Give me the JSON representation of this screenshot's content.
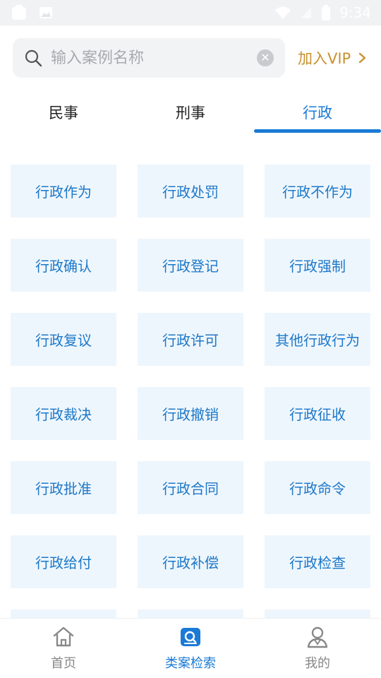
{
  "status_bar": {
    "time": "9:34",
    "left_icons": [
      "notification-icon",
      "image-icon"
    ],
    "right_icons": [
      "wifi-icon",
      "signal-icon",
      "battery-icon"
    ]
  },
  "search": {
    "placeholder": "输入案例名称",
    "value": ""
  },
  "vip": {
    "label": "加入VIP"
  },
  "tabs": [
    {
      "label": "民事",
      "active": false
    },
    {
      "label": "刑事",
      "active": false
    },
    {
      "label": "行政",
      "active": true
    }
  ],
  "categories": [
    "行政作为",
    "行政处罚",
    "行政不作为",
    "行政确认",
    "行政登记",
    "行政强制",
    "行政复议",
    "行政许可",
    "其他行政行为",
    "行政裁决",
    "行政撤销",
    "行政征收",
    "行政批准",
    "行政合同",
    "行政命令",
    "行政给付",
    "行政补偿",
    "行政检查"
  ],
  "bottom_nav": [
    {
      "label": "首页",
      "icon": "home-icon",
      "active": false
    },
    {
      "label": "类案检索",
      "icon": "case-search-icon",
      "active": true
    },
    {
      "label": "我的",
      "icon": "profile-icon",
      "active": false
    }
  ],
  "colors": {
    "accent": "#1a7ad6",
    "vip": "#c8912d",
    "cell_bg": "#eef6fd",
    "cell_text": "#1d78c8"
  }
}
